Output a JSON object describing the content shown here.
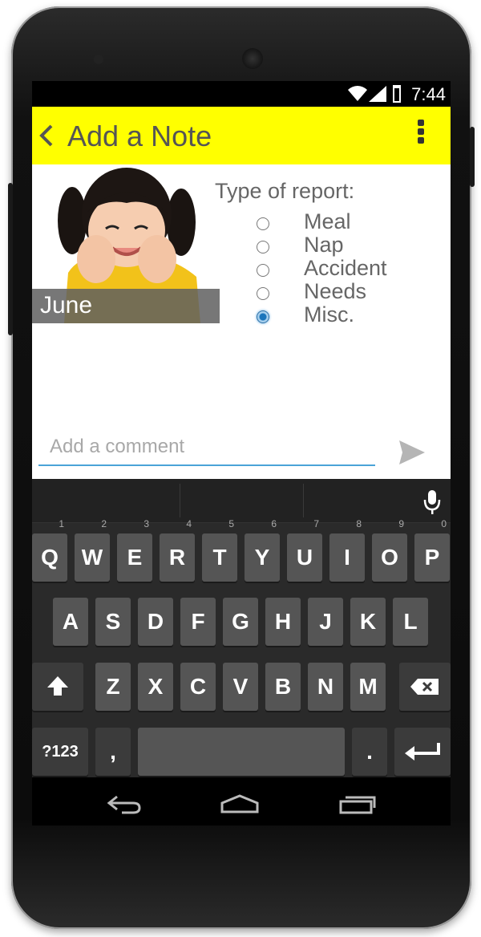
{
  "status_bar": {
    "time": "7:44"
  },
  "app_bar": {
    "title": "Add a Note"
  },
  "child": {
    "name": "June"
  },
  "report": {
    "label": "Type of report:",
    "options": [
      {
        "label": "Meal",
        "checked": false
      },
      {
        "label": "Nap",
        "checked": false
      },
      {
        "label": "Accident",
        "checked": false
      },
      {
        "label": "Needs",
        "checked": false
      },
      {
        "label": "Misc.",
        "checked": true
      }
    ]
  },
  "comment": {
    "placeholder": "Add a comment"
  },
  "keyboard": {
    "row1": [
      {
        "label": "Q",
        "sub": "1"
      },
      {
        "label": "W",
        "sub": "2"
      },
      {
        "label": "E",
        "sub": "3"
      },
      {
        "label": "R",
        "sub": "4"
      },
      {
        "label": "T",
        "sub": "5"
      },
      {
        "label": "Y",
        "sub": "6"
      },
      {
        "label": "U",
        "sub": "7"
      },
      {
        "label": "I",
        "sub": "8"
      },
      {
        "label": "O",
        "sub": "9"
      },
      {
        "label": "P",
        "sub": "0"
      }
    ],
    "row2": [
      "A",
      "S",
      "D",
      "F",
      "G",
      "H",
      "J",
      "K",
      "L"
    ],
    "row3": [
      "Z",
      "X",
      "C",
      "V",
      "B",
      "N",
      "M"
    ],
    "symbols_label": "?123",
    "comma_label": ",",
    "period_label": "."
  },
  "colors": {
    "app_bar": "#ffff00",
    "accent": "#4aa3d8"
  },
  "icons": [
    "back-icon",
    "overflow-menu-icon",
    "send-icon",
    "mic-icon",
    "shift-icon",
    "backspace-icon",
    "enter-icon",
    "nav-back-icon",
    "nav-home-icon",
    "nav-recents-icon",
    "wifi-icon",
    "signal-icon",
    "battery-icon"
  ]
}
